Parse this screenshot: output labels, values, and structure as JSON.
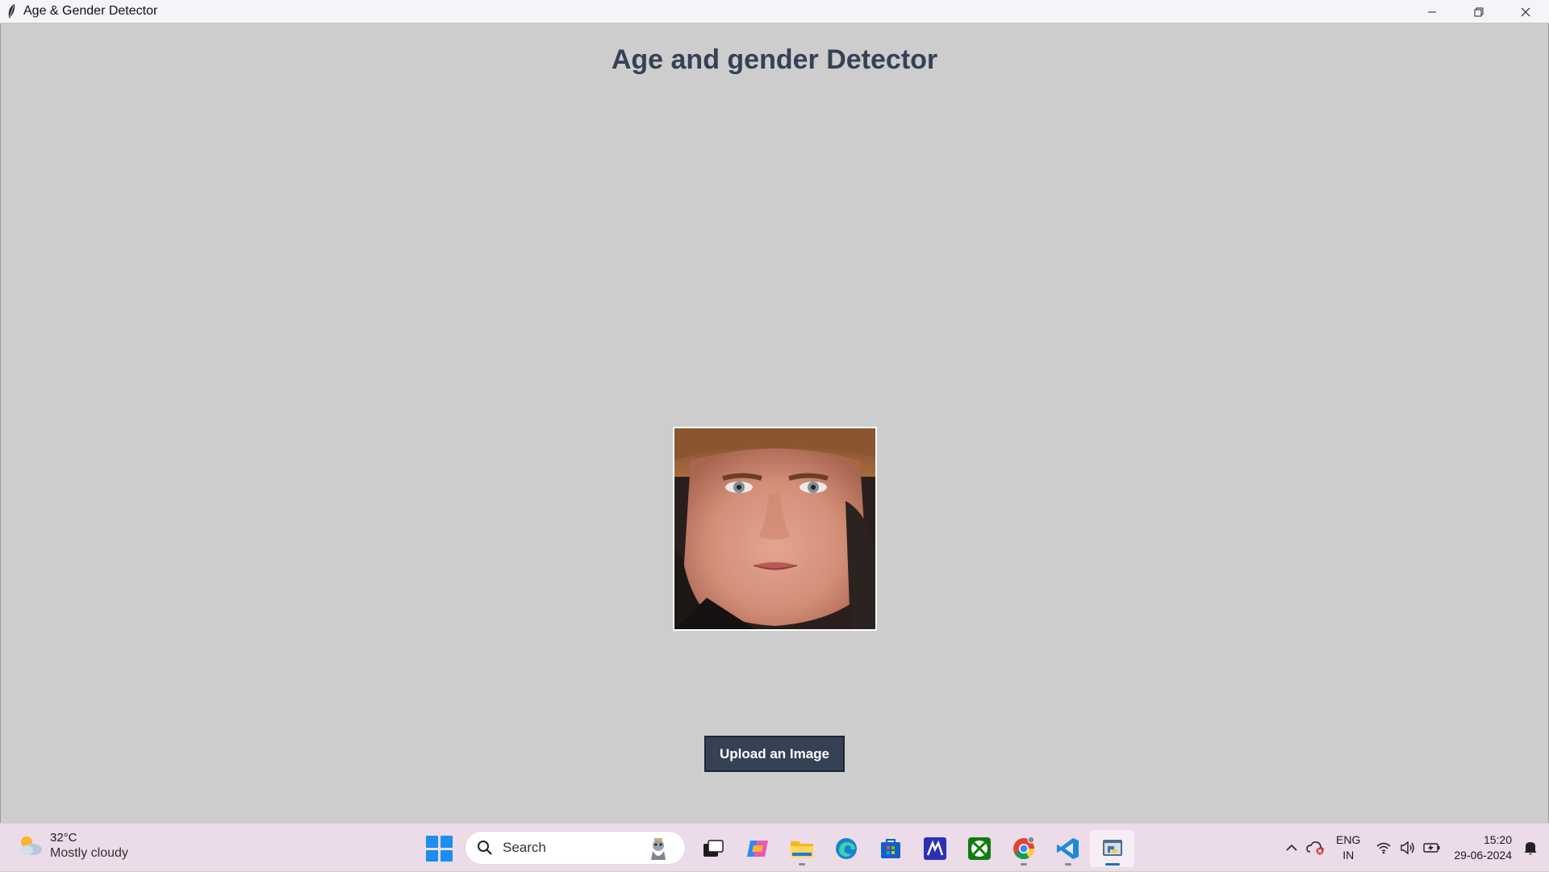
{
  "window": {
    "title": "Age & Gender Detector",
    "controls": [
      "minimize",
      "restore",
      "close"
    ]
  },
  "app": {
    "heading": "Age and gender Detector",
    "image": {
      "subject": "face-photo"
    },
    "upload_button_label": "Upload an Image"
  },
  "taskbar": {
    "weather": {
      "temp": "32°C",
      "condition": "Mostly cloudy"
    },
    "search": {
      "placeholder": "Search"
    },
    "apps": [
      "task-view",
      "copilot",
      "file-explorer",
      "edge",
      "microsoft-store",
      "app-launcher",
      "xbox",
      "chrome",
      "vscode",
      "python-tk"
    ],
    "language": {
      "line1": "ENG",
      "line2": "IN"
    },
    "clock": {
      "time": "15:20",
      "date": "29-06-2024"
    }
  },
  "colors": {
    "app_background": "#cdcdcd",
    "heading": "#364156",
    "button": "#364156",
    "button_text": "#ffffff",
    "taskbar": "#ecdbe8"
  }
}
